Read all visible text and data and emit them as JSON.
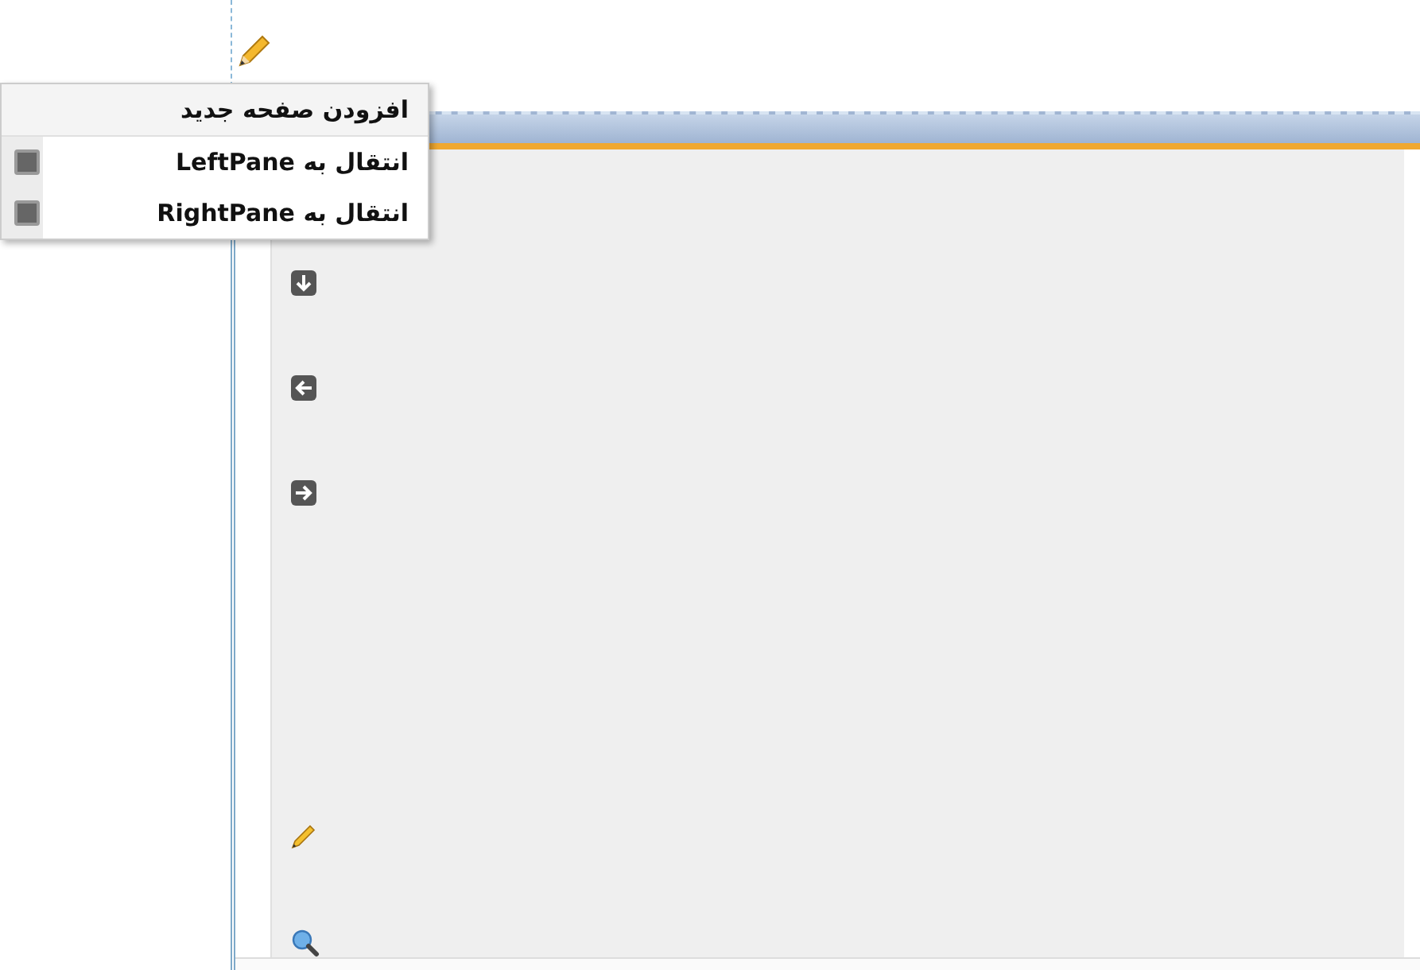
{
  "menu": {
    "items": [
      {
        "label": "افزودن صفحه جدید",
        "kind": "plain",
        "selected": true
      },
      {
        "label": "انتقال به LeftPane",
        "kind": "move",
        "selected": false
      },
      {
        "label": "انتقال به RightPane",
        "kind": "move",
        "selected": false
      }
    ]
  },
  "panel": {
    "tools": [
      {
        "kind": "down"
      },
      {
        "kind": "left"
      },
      {
        "kind": "right"
      },
      {
        "kind": "gap"
      },
      {
        "kind": "edit"
      },
      {
        "kind": "zoom"
      }
    ]
  }
}
